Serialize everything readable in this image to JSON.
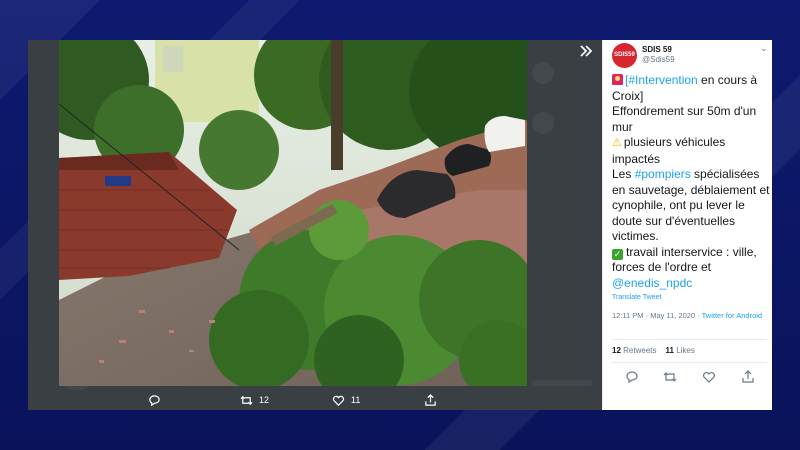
{
  "media_viewer": {
    "collapse_icon": "double-chevron-right-icon",
    "photo_sign_text": "",
    "actions": {
      "reply": {
        "icon": "reply-icon",
        "count": ""
      },
      "retweet": {
        "icon": "retweet-icon",
        "count": "12"
      },
      "like": {
        "icon": "heart-icon",
        "count": "11"
      },
      "share": {
        "icon": "share-icon",
        "count": ""
      }
    }
  },
  "tweet": {
    "display_name": "SDIS 59",
    "handle": "@Sdis59",
    "avatar_text": "SDIS59",
    "body": {
      "hashtag_intervention": "[#Intervention",
      "line1_rest": " en cours à",
      "line2": "Croix]",
      "line3": "Effondrement sur 50m d'un",
      "line4": "mur",
      "line5": "plusieurs véhicules",
      "line6": "impactés",
      "line7_prefix": "Les ",
      "hashtag_pompiers": "#pompiers",
      "line7_rest": " spécialisées",
      "line8": "en sauvetage, déblaiement et",
      "line9": "cynophile, ont pu lever le",
      "line10": "doute sur d'éventuelles",
      "line11": "victimes.",
      "line12": "travail interservice : ville,",
      "line13": "forces de l'ordre et",
      "mention": "@enedis_npdc"
    },
    "translate_label": "Translate Tweet",
    "timestamp": "12:11 PM · May 11, 2020 · ",
    "source": "Twitter for Android",
    "retweets_count": "12",
    "retweets_label": "Retweets",
    "likes_count": "11",
    "likes_label": "Likes"
  },
  "colors": {
    "background_blue": "#0f1a66",
    "overlay_dark": "#2f3336",
    "link_blue": "#1da1f2",
    "avatar_red": "#d7262d"
  }
}
